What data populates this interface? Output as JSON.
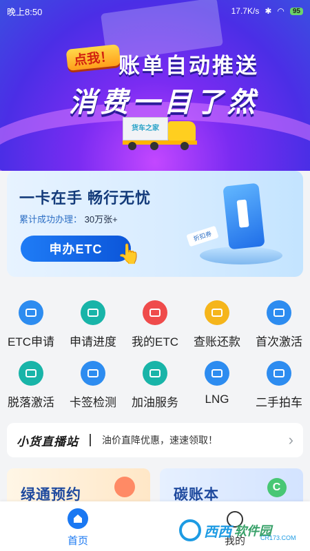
{
  "status_bar": {
    "time": "晚上8:50",
    "network_speed": "17.7K/s",
    "battery": "95"
  },
  "hero": {
    "tag": "点我！",
    "title_line1": "账单自动推送",
    "title_line2": "消费一目了然",
    "truck_label": "货车之家"
  },
  "etc_card": {
    "slogan": "一卡在手 畅行无忧",
    "count_label": "累计成功办理：",
    "count_value": "30万张+",
    "button_label": "申办ETC",
    "coupon_label": "折扣券"
  },
  "grid": {
    "items": [
      {
        "label": "ETC申请",
        "icon": "etc-card-icon",
        "color": "#2d8cf0"
      },
      {
        "label": "申请进度",
        "icon": "progress-card-icon",
        "color": "#18b4a8"
      },
      {
        "label": "我的ETC",
        "icon": "wallet-icon",
        "color": "#ef4b4b"
      },
      {
        "label": "查账还款",
        "icon": "yuan-icon",
        "color": "#f5b51b"
      },
      {
        "label": "首次激活",
        "icon": "signal-icon",
        "color": "#2d8cf0"
      },
      {
        "label": "脱落激活",
        "icon": "reattach-icon",
        "color": "#18b4a8"
      },
      {
        "label": "卡签检测",
        "icon": "search-card-icon",
        "color": "#2d8cf0"
      },
      {
        "label": "加油服务",
        "icon": "fuel-icon",
        "color": "#18b4a8"
      },
      {
        "label": "LNG",
        "icon": "gas-pump-icon",
        "color": "#2d8cf0"
      },
      {
        "label": "二手拍车",
        "icon": "truck-yuan-icon",
        "color": "#2d8cf0"
      }
    ]
  },
  "live_bar": {
    "title": "小货直播站",
    "text": "油价直降优惠，速速领取！"
  },
  "cards": {
    "green_pass": "绿通预约",
    "carbon": "碳账本"
  },
  "tabs": {
    "home": "首页",
    "mine": "我的"
  },
  "watermark": {
    "text1": "西西",
    "text2": "软件园",
    "sub": "CR173.COM"
  },
  "colors": {
    "accent": "#1a78f2",
    "hero_purple": "#7a2cf2"
  }
}
